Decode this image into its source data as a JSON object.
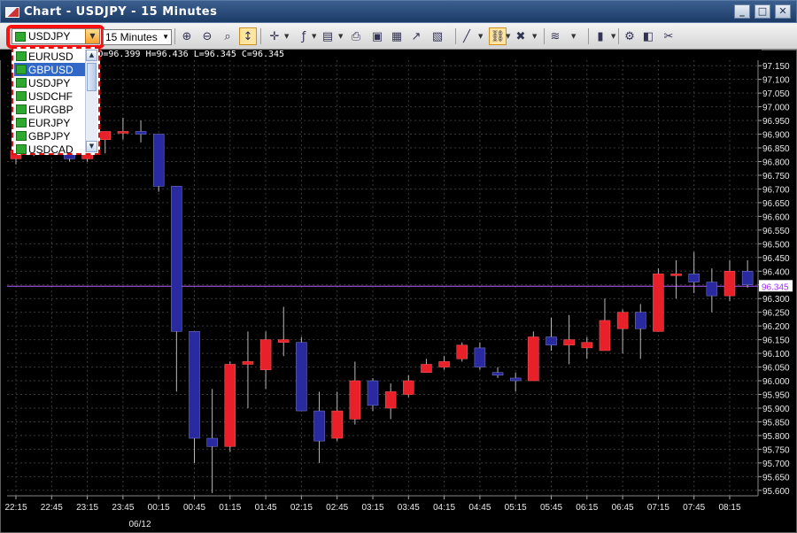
{
  "window": {
    "title": "Chart - USDJPY - 15 Minutes",
    "minimize": "_",
    "restore": "□",
    "close": "✕"
  },
  "toolbar": {
    "symbol": "USDJPY",
    "period": "15 Minutes",
    "icons": [
      "zoom-in-icon",
      "zoom-out-icon",
      "zoom-fit-icon",
      "auto-scale-icon",
      "crosshair-icon",
      "indicator-icon",
      "template-icon",
      "print-icon",
      "save-icon",
      "export-icon",
      "line-chart-icon",
      "report-icon",
      "draw-line-icon",
      "link-icon",
      "delete-drawing-icon",
      "fibonacci-icon",
      "candle-chart-icon",
      "settings-icon",
      "eraser-icon",
      "tools-icon"
    ]
  },
  "dropdown": {
    "items": [
      "EURUSD",
      "GBPUSD",
      "USDJPY",
      "USDCHF",
      "EURGBP",
      "EURJPY",
      "GBPJPY",
      "USDCAD"
    ],
    "highlighted": "GBPUSD"
  },
  "info_line": "USDJPY,M15 2:00 O=96.399 H=96.436 L=96.345 C=96.345",
  "chart_data": {
    "type": "candlestick",
    "symbol": "USDJPY",
    "timeframe": "15 Minutes",
    "colors": {
      "bull": "#e8202a",
      "bear": "#2a2aa0",
      "wick": "#b8b8b8",
      "bg": "#000000",
      "grid": "#3a3a3a",
      "price_line": "#b060ff"
    },
    "ylim": [
      95.58,
      97.17
    ],
    "y_ticks": [
      95.6,
      95.65,
      95.7,
      95.75,
      95.8,
      95.85,
      95.9,
      95.95,
      96.0,
      96.05,
      96.1,
      96.15,
      96.2,
      96.25,
      96.3,
      96.35,
      96.4,
      96.45,
      96.5,
      96.55,
      96.6,
      96.65,
      96.7,
      96.75,
      96.8,
      96.85,
      96.9,
      96.95,
      97.0,
      97.05,
      97.1,
      97.15
    ],
    "x_labels": [
      "22:15",
      "22:45",
      "23:15",
      "23:45",
      "00:15",
      "00:45",
      "01:15",
      "01:45",
      "02:15",
      "02:45",
      "03:15",
      "03:45",
      "04:15",
      "04:45",
      "05:15",
      "05:45",
      "06:15",
      "06:45",
      "07:15",
      "07:45",
      "08:15"
    ],
    "date_label": "06/12",
    "current_price": "96.345",
    "candles": [
      {
        "t": "22:15",
        "o": 96.81,
        "h": 96.86,
        "l": 96.79,
        "c": 96.84
      },
      {
        "t": "22:30",
        "o": 96.84,
        "h": 96.88,
        "l": 96.82,
        "c": 96.86
      },
      {
        "t": "22:45",
        "o": 96.86,
        "h": 96.9,
        "l": 96.83,
        "c": 96.85
      },
      {
        "t": "23:00",
        "o": 96.85,
        "h": 96.87,
        "l": 96.8,
        "c": 96.81
      },
      {
        "t": "23:15",
        "o": 96.81,
        "h": 96.92,
        "l": 96.8,
        "c": 96.89
      },
      {
        "t": "23:30",
        "o": 96.88,
        "h": 96.91,
        "l": 96.83,
        "c": 96.91
      },
      {
        "t": "23:45",
        "o": 96.91,
        "h": 96.96,
        "l": 96.88,
        "c": 96.91
      },
      {
        "t": "00:00",
        "o": 96.91,
        "h": 96.95,
        "l": 96.87,
        "c": 96.9
      },
      {
        "t": "00:15",
        "o": 96.9,
        "h": 96.9,
        "l": 96.69,
        "c": 96.71
      },
      {
        "t": "00:30",
        "o": 96.71,
        "h": 96.71,
        "l": 95.96,
        "c": 96.18
      },
      {
        "t": "00:45",
        "o": 96.18,
        "h": 96.18,
        "l": 95.7,
        "c": 95.79
      },
      {
        "t": "01:00",
        "o": 95.79,
        "h": 95.97,
        "l": 95.59,
        "c": 95.76
      },
      {
        "t": "01:15",
        "o": 95.76,
        "h": 96.07,
        "l": 95.74,
        "c": 96.06
      },
      {
        "t": "01:30",
        "o": 96.06,
        "h": 96.18,
        "l": 95.9,
        "c": 96.07
      },
      {
        "t": "01:45",
        "o": 96.04,
        "h": 96.18,
        "l": 95.97,
        "c": 96.15
      },
      {
        "t": "02:00",
        "o": 96.14,
        "h": 96.27,
        "l": 96.09,
        "c": 96.15
      },
      {
        "t": "02:15",
        "o": 96.14,
        "h": 96.16,
        "l": 95.89,
        "c": 95.89
      },
      {
        "t": "02:30",
        "o": 95.89,
        "h": 95.96,
        "l": 95.7,
        "c": 95.78
      },
      {
        "t": "02:45",
        "o": 95.79,
        "h": 95.96,
        "l": 95.78,
        "c": 95.89
      },
      {
        "t": "03:00",
        "o": 95.86,
        "h": 96.07,
        "l": 95.84,
        "c": 96.0
      },
      {
        "t": "03:15",
        "o": 96.0,
        "h": 96.01,
        "l": 95.89,
        "c": 95.91
      },
      {
        "t": "03:30",
        "o": 95.9,
        "h": 95.99,
        "l": 95.86,
        "c": 95.96
      },
      {
        "t": "03:45",
        "o": 95.95,
        "h": 96.02,
        "l": 95.94,
        "c": 96.0
      },
      {
        "t": "04:00",
        "o": 96.03,
        "h": 96.08,
        "l": 96.03,
        "c": 96.06
      },
      {
        "t": "04:15",
        "o": 96.05,
        "h": 96.09,
        "l": 96.04,
        "c": 96.07
      },
      {
        "t": "04:30",
        "o": 96.08,
        "h": 96.14,
        "l": 96.07,
        "c": 96.13
      },
      {
        "t": "04:45",
        "o": 96.12,
        "h": 96.14,
        "l": 96.04,
        "c": 96.05
      },
      {
        "t": "05:00",
        "o": 96.03,
        "h": 96.05,
        "l": 96.01,
        "c": 96.02
      },
      {
        "t": "05:15",
        "o": 96.01,
        "h": 96.03,
        "l": 95.96,
        "c": 96.0
      },
      {
        "t": "05:30",
        "o": 96.0,
        "h": 96.18,
        "l": 96.0,
        "c": 96.16
      },
      {
        "t": "05:45",
        "o": 96.16,
        "h": 96.23,
        "l": 96.11,
        "c": 96.13
      },
      {
        "t": "06:00",
        "o": 96.13,
        "h": 96.24,
        "l": 96.06,
        "c": 96.15
      },
      {
        "t": "06:15",
        "o": 96.12,
        "h": 96.16,
        "l": 96.08,
        "c": 96.14
      },
      {
        "t": "06:30",
        "o": 96.11,
        "h": 96.3,
        "l": 96.11,
        "c": 96.22
      },
      {
        "t": "06:45",
        "o": 96.19,
        "h": 96.26,
        "l": 96.1,
        "c": 96.25
      },
      {
        "t": "07:00",
        "o": 96.25,
        "h": 96.28,
        "l": 96.08,
        "c": 96.19
      },
      {
        "t": "07:15",
        "o": 96.18,
        "h": 96.41,
        "l": 96.18,
        "c": 96.39
      },
      {
        "t": "07:30",
        "o": 96.39,
        "h": 96.44,
        "l": 96.3,
        "c": 96.39
      },
      {
        "t": "07:45",
        "o": 96.39,
        "h": 96.47,
        "l": 96.32,
        "c": 96.36
      },
      {
        "t": "08:00",
        "o": 96.36,
        "h": 96.41,
        "l": 96.25,
        "c": 96.31
      },
      {
        "t": "08:15",
        "o": 96.31,
        "h": 96.44,
        "l": 96.29,
        "c": 96.4
      },
      {
        "t": "08:30",
        "o": 96.4,
        "h": 96.44,
        "l": 96.34,
        "c": 96.35
      }
    ]
  }
}
